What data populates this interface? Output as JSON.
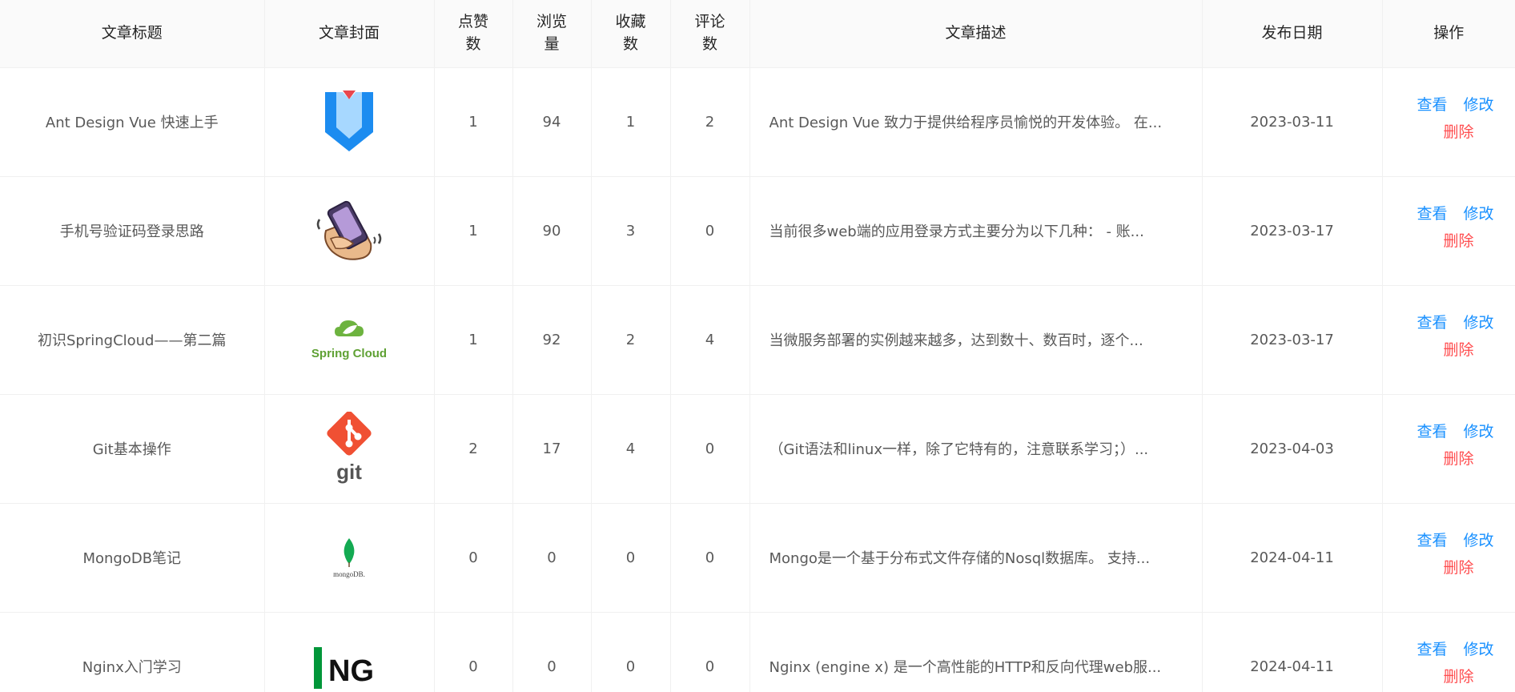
{
  "table": {
    "columns": [
      {
        "label": "文章标题"
      },
      {
        "label": "文章封面"
      },
      {
        "label": "点赞\n数"
      },
      {
        "label": "浏览\n量"
      },
      {
        "label": "收藏\n数"
      },
      {
        "label": "评论\n数"
      },
      {
        "label": "文章描述"
      },
      {
        "label": "发布日期"
      },
      {
        "label": "操作"
      }
    ],
    "rows": [
      {
        "title": "Ant Design Vue 快速上手",
        "cover_icon": "ant-design-vue-logo-icon",
        "likes": "1",
        "views": "94",
        "favorites": "1",
        "comments": "2",
        "description": "Ant Design Vue 致力于提供给程序员愉悦的开发体验。 在...",
        "date": "2023-03-11"
      },
      {
        "title": "手机号验证码登录思路",
        "cover_icon": "phone-in-hand-icon",
        "likes": "1",
        "views": "90",
        "favorites": "3",
        "comments": "0",
        "description": "当前很多web端的应用登录方式主要分为以下几种： - 账...",
        "date": "2023-03-17"
      },
      {
        "title": "初识SpringCloud——第二篇",
        "cover_icon": "spring-cloud-logo-icon",
        "cover_text": "Spring Cloud",
        "likes": "1",
        "views": "92",
        "favorites": "2",
        "comments": "4",
        "description": "当微服务部署的实例越来越多，达到数十、数百时，逐个...",
        "date": "2023-03-17"
      },
      {
        "title": "Git基本操作",
        "cover_icon": "git-logo-icon",
        "cover_text": "git",
        "likes": "2",
        "views": "17",
        "favorites": "4",
        "comments": "0",
        "description": "（Git语法和linux一样，除了它特有的，注意联系学习；）...",
        "date": "2023-04-03"
      },
      {
        "title": "MongoDB笔记",
        "cover_icon": "mongodb-logo-icon",
        "cover_text": "mongoDB.",
        "likes": "0",
        "views": "0",
        "favorites": "0",
        "comments": "0",
        "description": "Mongo是一个基于分布式文件存储的Nosql数据库。 支持...",
        "date": "2024-04-11"
      },
      {
        "title": "Nginx入门学习",
        "cover_icon": "nginx-logo-icon",
        "cover_text": "NG",
        "likes": "0",
        "views": "0",
        "favorites": "0",
        "comments": "0",
        "description": "Nginx (engine x) 是一个高性能的HTTP和反向代理web服...",
        "date": "2024-04-11"
      }
    ],
    "actions": {
      "view_label": "查看",
      "edit_label": "修改",
      "delete_label": "删除"
    }
  },
  "colors": {
    "link": "#1890ff",
    "danger": "#ff4d4f",
    "header_bg": "#fafafa",
    "border": "#f0f0f0"
  }
}
